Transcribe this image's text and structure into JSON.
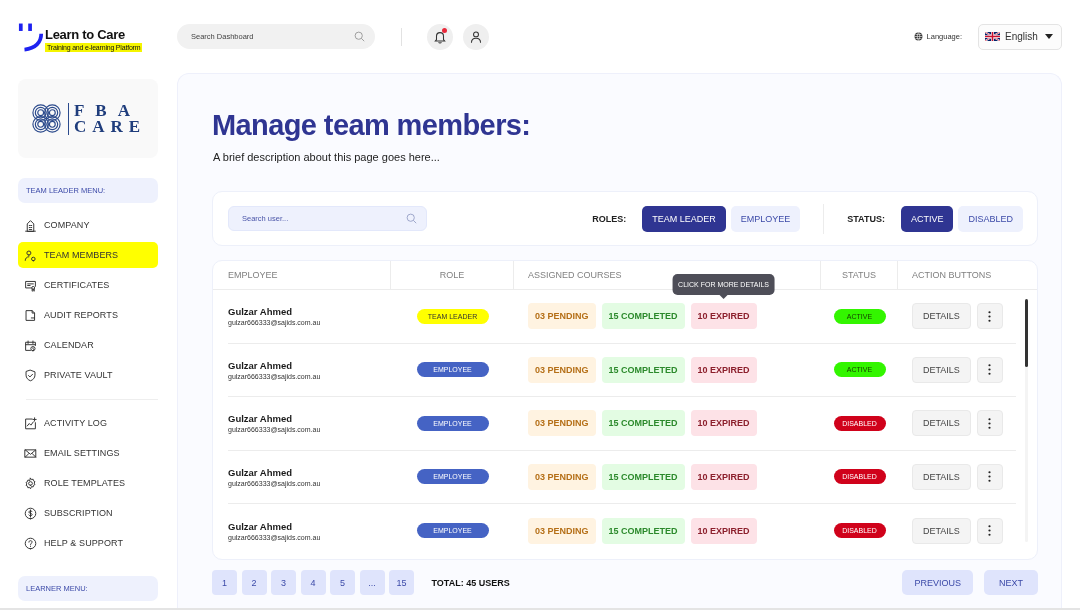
{
  "header": {
    "logo": {
      "name": "Learn to Care",
      "tagline": "Training and e-learning Platform"
    },
    "search": {
      "placeholder": "Search Dashboard"
    },
    "notifications": {
      "unread": true
    },
    "language": {
      "label": "Language:",
      "value": "English"
    }
  },
  "sidebar": {
    "organization_logo": {
      "line_1": "FBA",
      "line_2": "CARE"
    },
    "menus": [
      {
        "heading": "TEAM LEADER MENU:",
        "groups": [
          {
            "items": [
              {
                "label": "COMPANY",
                "selected": false
              },
              {
                "label": "TEAM MEMBERS",
                "selected": true
              },
              {
                "label": "CERTIFICATES",
                "selected": false
              },
              {
                "label": "AUDIT REPORTS",
                "selected": false
              },
              {
                "label": "CALENDAR",
                "selected": false
              },
              {
                "label": "PRIVATE VAULT",
                "selected": false
              }
            ]
          },
          {
            "items": [
              {
                "label": "ACTIVITY LOG",
                "selected": false
              },
              {
                "label": "EMAIL SETTINGS",
                "selected": false
              },
              {
                "label": "ROLE TEMPLATES",
                "selected": false
              },
              {
                "label": "SUBSCRIPTION",
                "selected": false
              },
              {
                "label": "HELP & SUPPORT",
                "selected": false
              }
            ]
          }
        ]
      },
      {
        "heading": "LEARNER MENU:"
      }
    ]
  },
  "page": {
    "title": "Manage team members:",
    "description": "A brief description about this page goes here..."
  },
  "filters": {
    "search": {
      "placeholder": "Search user..."
    },
    "roles": {
      "label": "ROLES:",
      "options": [
        {
          "label": "TEAM LEADER",
          "selected": true
        },
        {
          "label": "EMPLOYEE",
          "selected": false
        }
      ]
    },
    "status": {
      "label": "STATUS:",
      "options": [
        {
          "label": "ACTIVE",
          "selected": true
        },
        {
          "label": "DISABLED",
          "selected": false
        }
      ]
    }
  },
  "table": {
    "columns": [
      "EMPLOYEE",
      "ROLE",
      "ASSIGNED COURSES",
      "STATUS",
      "ACTION BUTTONS"
    ],
    "rows": [
      {
        "name": "Gulzar Ahmed",
        "email": "gulzar666333@sajids.com.au",
        "role": {
          "label": "TEAM LEADER",
          "kind": "team_leader"
        },
        "courses": [
          {
            "label": "03 PENDING",
            "kind": "pending"
          },
          {
            "label": "15 COMPLETED",
            "kind": "completed"
          },
          {
            "label": "10 EXPIRED",
            "kind": "expired",
            "tooltip": "CLICK FOR MORE DETAILS"
          }
        ],
        "status": {
          "label": "ACTIVE",
          "kind": "active"
        },
        "details_button": "DETAILS"
      },
      {
        "name": "Gulzar Ahmed",
        "email": "gulzar666333@sajids.com.au",
        "role": {
          "label": "EMPLOYEE",
          "kind": "employee"
        },
        "courses": [
          {
            "label": "03 PENDING",
            "kind": "pending"
          },
          {
            "label": "15 COMPLETED",
            "kind": "completed"
          },
          {
            "label": "10 EXPIRED",
            "kind": "expired"
          }
        ],
        "status": {
          "label": "ACTIVE",
          "kind": "active"
        },
        "details_button": "DETAILS"
      },
      {
        "name": "Gulzar Ahmed",
        "email": "gulzar666333@sajids.com.au",
        "role": {
          "label": "EMPLOYEE",
          "kind": "employee"
        },
        "courses": [
          {
            "label": "03 PENDING",
            "kind": "pending"
          },
          {
            "label": "15 COMPLETED",
            "kind": "completed"
          },
          {
            "label": "10 EXPIRED",
            "kind": "expired"
          }
        ],
        "status": {
          "label": "DISABLED",
          "kind": "disabled"
        },
        "details_button": "DETAILS"
      },
      {
        "name": "Gulzar Ahmed",
        "email": "gulzar666333@sajids.com.au",
        "role": {
          "label": "EMPLOYEE",
          "kind": "employee"
        },
        "courses": [
          {
            "label": "03 PENDING",
            "kind": "pending"
          },
          {
            "label": "15 COMPLETED",
            "kind": "completed"
          },
          {
            "label": "10 EXPIRED",
            "kind": "expired"
          }
        ],
        "status": {
          "label": "DISABLED",
          "kind": "disabled"
        },
        "details_button": "DETAILS"
      },
      {
        "name": "Gulzar Ahmed",
        "email": "gulzar666333@sajids.com.au",
        "role": {
          "label": "EMPLOYEE",
          "kind": "employee"
        },
        "courses": [
          {
            "label": "03 PENDING",
            "kind": "pending"
          },
          {
            "label": "15 COMPLETED",
            "kind": "completed"
          },
          {
            "label": "10 EXPIRED",
            "kind": "expired"
          }
        ],
        "status": {
          "label": "DISABLED",
          "kind": "disabled"
        },
        "details_button": "DETAILS"
      }
    ]
  },
  "pagination": {
    "pages": [
      {
        "label": "1",
        "selected": false
      },
      {
        "label": "2",
        "selected": false
      },
      {
        "label": "3",
        "selected": false
      },
      {
        "label": "4",
        "selected": false
      },
      {
        "label": "5",
        "selected": false
      },
      {
        "label": "...",
        "selected": false
      },
      {
        "label": "15",
        "selected": false
      }
    ],
    "total": "TOTAL: 45 USERS",
    "previous": "PREVIOUS",
    "next": "NEXT"
  }
}
